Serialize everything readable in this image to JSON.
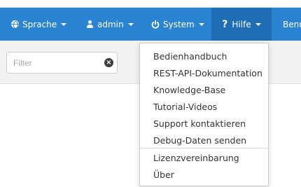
{
  "navbar": {
    "sprache_label": "Sprache",
    "admin_label": "admin",
    "system_label": "System",
    "hilfe_icon": "?",
    "hilfe_label": "Hilfe",
    "benu_label": "Benu"
  },
  "filter": {
    "placeholder": "Filter",
    "clear_icon": "×"
  },
  "help_menu": {
    "items": [
      "Bedienhandbuch",
      "REST-API-Dokumentation",
      "Knowledge-Base",
      "Tutorial-Videos",
      "Support kontaktieren",
      "Debug-Daten senden",
      "Lizenzvereinbarung",
      "Über"
    ]
  }
}
